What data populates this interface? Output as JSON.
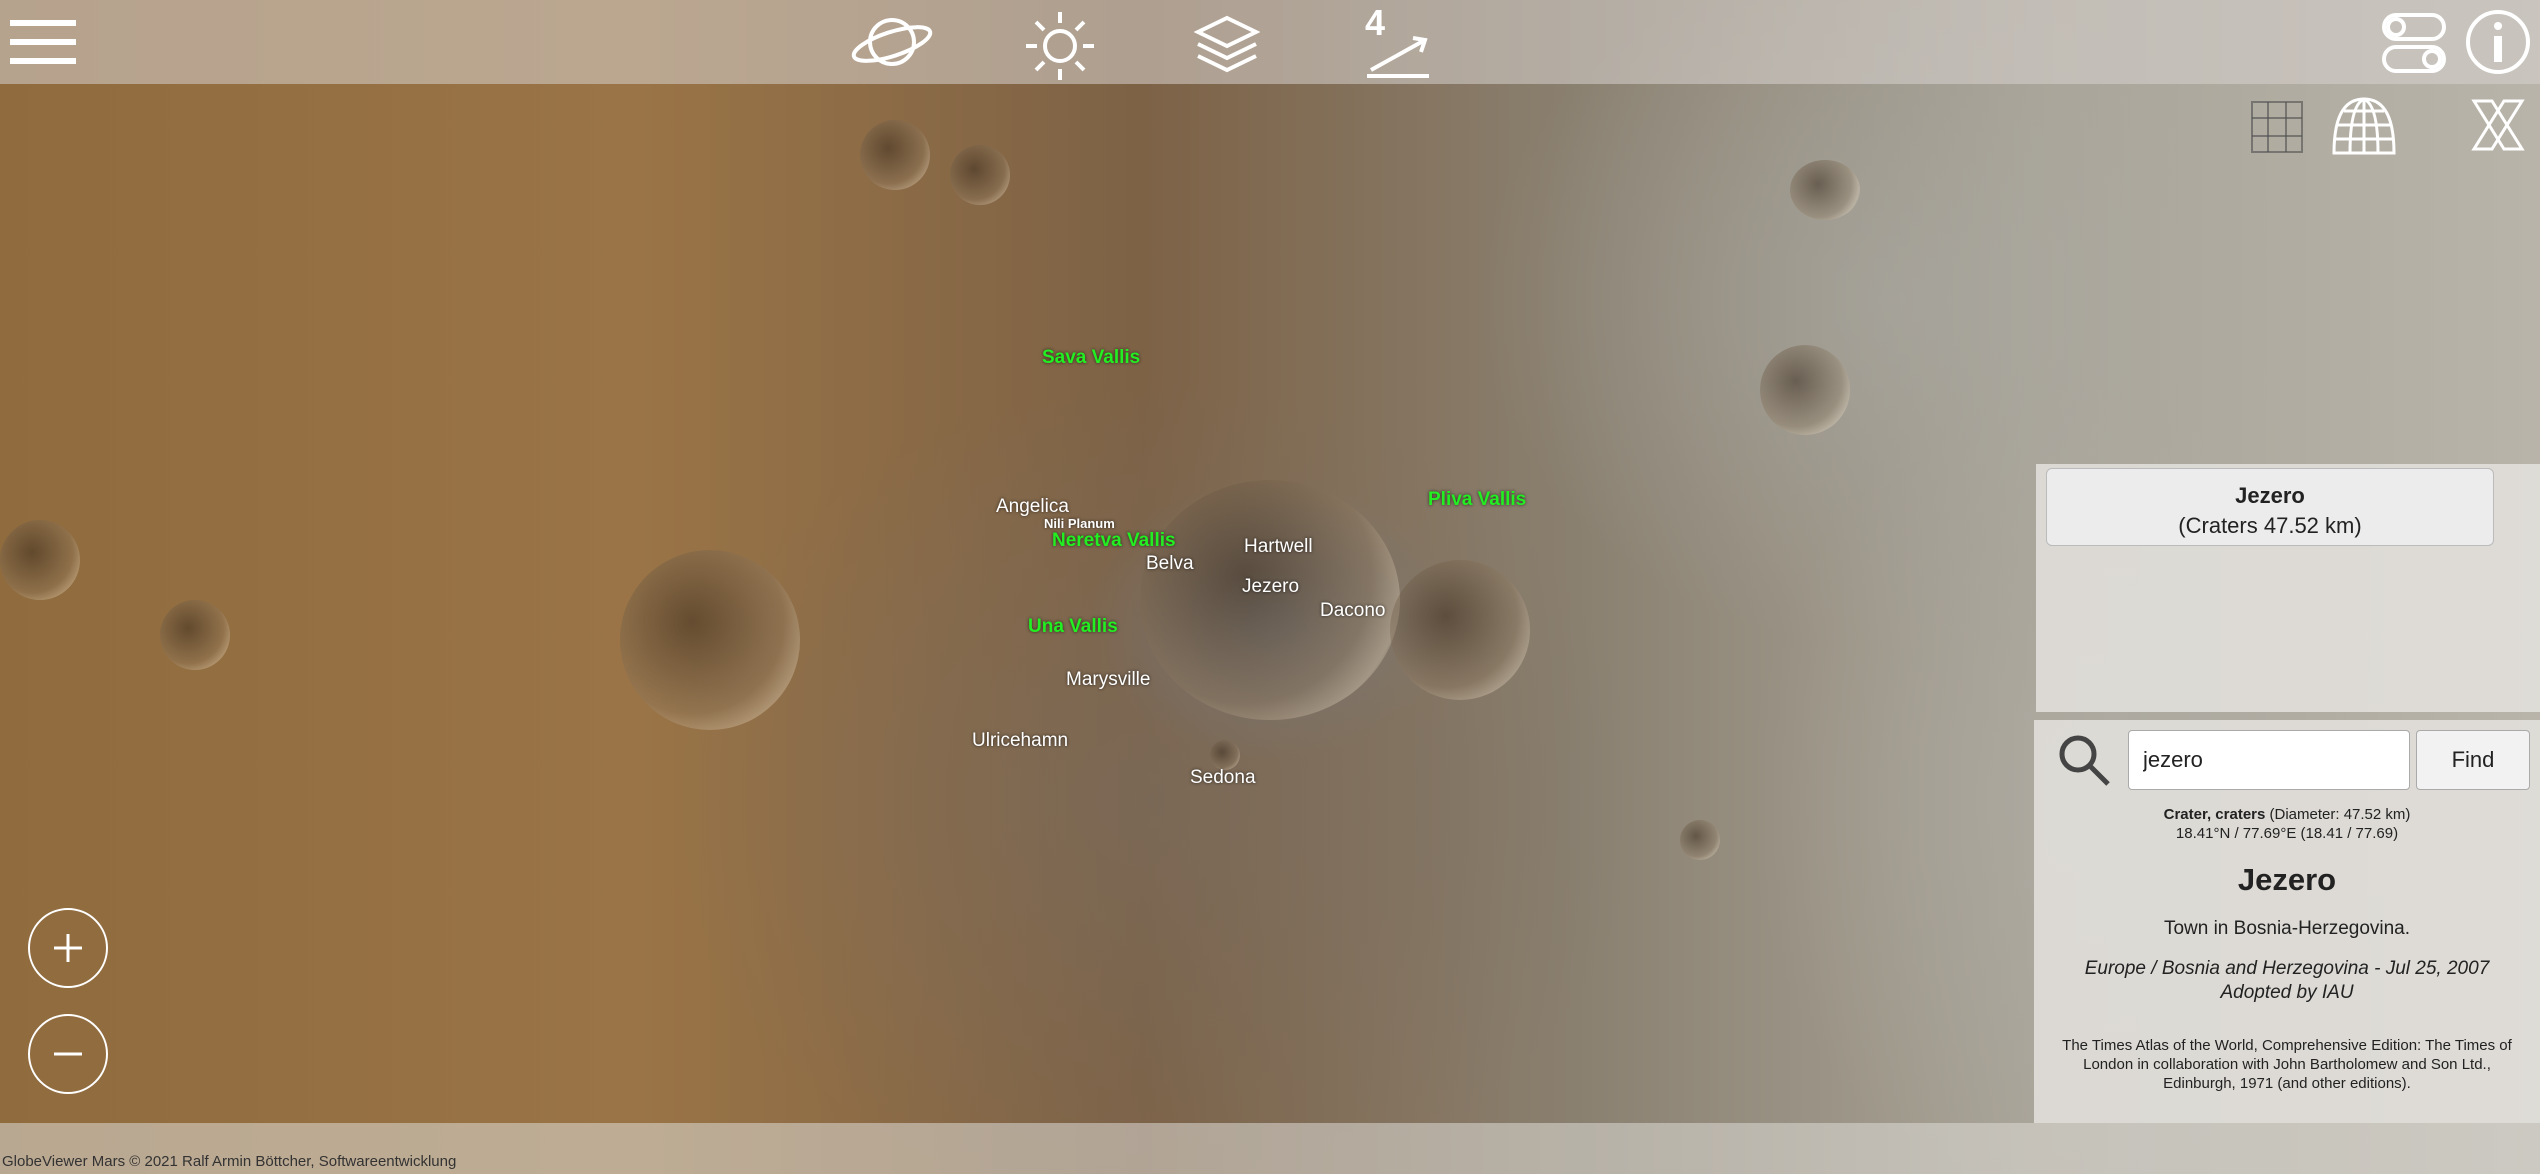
{
  "toolbar": {
    "menu_icon": "hamburger-menu-icon",
    "globe_icon": "planet-icon",
    "lighting_icon": "sun-icon",
    "layers_icon": "layers-icon",
    "measure_badge": "4",
    "measure_icon": "distance-measure-icon",
    "toggle_icon": "toggle-switches-icon",
    "info_icon": "info-icon"
  },
  "overlay_tools": {
    "grid_icon": "grid-icon",
    "dome_icon": "globe-grid-icon",
    "close_icon": "x-icon"
  },
  "map_labels": {
    "sava_vallis": "Sava Vallis",
    "pliva_vallis": "Pliva Vallis",
    "angelica": "Angelica",
    "nili_planum": "Nili Planum",
    "neretva_vallis": "Neretva Vallis",
    "hartwell": "Hartwell",
    "belva": "Belva",
    "jezero": "Jezero",
    "dacono": "Dacono",
    "una_vallis": "Una Vallis",
    "marysville": "Marysville",
    "ulricehamn": "Ulricehamn",
    "sedona": "Sedona"
  },
  "feature_panel": {
    "name": "Jezero",
    "subtitle": "(Craters 47.52 km)"
  },
  "search": {
    "value": "jezero",
    "find_label": "Find",
    "icon": "magnifier-icon"
  },
  "info": {
    "type_bold": "Crater, craters",
    "type_rest": " (Diameter: 47.52 km)",
    "coords": "18.41°N / 77.69°E (18.41 / 77.69)",
    "title": "Jezero",
    "description": "Town in Bosnia-Herzegovina.",
    "origin": "Europe / Bosnia and Herzegovina - Jul 25, 2007",
    "adopted": "Adopted by IAU",
    "source": "The Times Atlas of the World, Comprehensive Edition: The Times of London in collaboration with John Bartholomew and Son Ltd., Edinburgh, 1971 (and other editions)."
  },
  "zoom": {
    "in_icon": "plus-icon",
    "out_icon": "minus-icon"
  },
  "footer": {
    "copyright": "GlobeViewer Mars © 2021 Ralf Armin Böttcher, Softwareentwicklung"
  }
}
